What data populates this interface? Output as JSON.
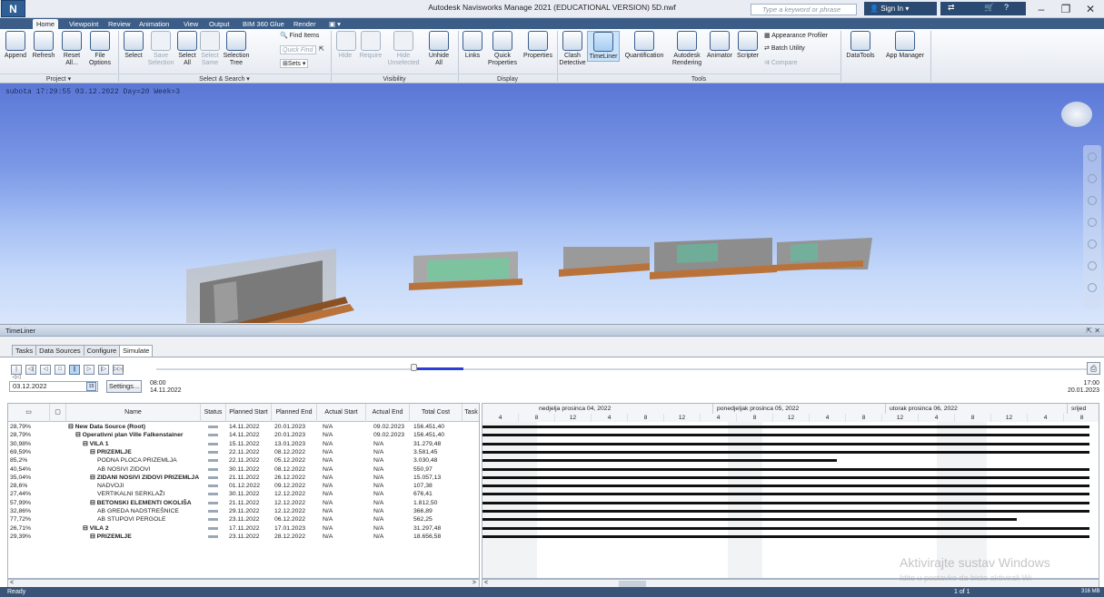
{
  "app": {
    "logo": "N",
    "title": "Autodesk Navisworks Manage 2021 (EDUCATIONAL VERSION)   5D.nwf",
    "search_placeholder": "Type a keyword or phrase",
    "signin": "Sign In",
    "window_controls": [
      "–",
      "❐",
      "✕"
    ]
  },
  "ribbon_tabs": [
    "Home",
    "Viewpoint",
    "Review",
    "Animation",
    "View",
    "Output",
    "BIM 360 Glue",
    "Render"
  ],
  "ribbon": {
    "project": {
      "label": "Project ▾",
      "buttons": [
        "Append",
        "Refresh",
        "Reset All...",
        "File Options"
      ]
    },
    "select_search": {
      "label": "Select & Search ▾",
      "buttons": [
        "Select",
        "Save Selection",
        "Select All",
        "Select Same",
        "Selection Tree"
      ],
      "find_items": "Find Items",
      "quick_find": "Quick Find",
      "sets": "Sets"
    },
    "visibility": {
      "label": "Visibility",
      "buttons": [
        "Hide",
        "Require",
        "Hide Unselected",
        "Unhide All"
      ]
    },
    "display": {
      "label": "Display",
      "buttons": [
        "Links",
        "Quick Properties",
        "Properties"
      ]
    },
    "tools": {
      "label": "Tools",
      "buttons": [
        "Clash Detective",
        "TimeLiner",
        "Quantification",
        "Autodesk Rendering",
        "Animator",
        "Scripter"
      ],
      "appearance_profiler": "Appearance Profiler",
      "batch_utility": "Batch Utility",
      "compare": "Compare"
    },
    "extra": [
      "DataTools",
      "App Manager"
    ]
  },
  "viewport": {
    "overlay": "subota 17:29:55 03.12.2022 Day=20 Week=3"
  },
  "timeliner": {
    "title": "TimeLiner",
    "close_controls": "⇱ ✕",
    "tabs": [
      "Tasks",
      "Data Sources",
      "Configure",
      "Simulate"
    ],
    "active_tab": "Simulate",
    "current_date": "03.12.2022",
    "calendar_icon": "15",
    "settings": "Settings...",
    "start_time": "08:00",
    "start_date": "14.11.2022",
    "end_time": "17:00",
    "end_date": "20.01.2023",
    "columns": [
      "",
      "",
      "Name",
      "Status",
      "Planned Start",
      "Planned End",
      "Actual Start",
      "Actual End",
      "Total Cost",
      "Task"
    ],
    "rows": [
      {
        "pct": "28,79%",
        "name": "⊟  New Data Source (Root)",
        "start": "14.11.2022",
        "end": "20.01.2023",
        "astart": "N/A",
        "aend": "09.02.2023",
        "cost": "156.451,40",
        "bold": true,
        "indent": 0
      },
      {
        "pct": "28,79%",
        "name": "⊟  Operativni plan  Ville Falkenstainer",
        "start": "14.11.2022",
        "end": "20.01.2023",
        "astart": "N/A",
        "aend": "09.02.2023",
        "cost": "156.451,40",
        "bold": true,
        "indent": 1
      },
      {
        "pct": "30,98%",
        "name": "⊟  VILA 1",
        "start": "15.11.2022",
        "end": "13.01.2023",
        "astart": "N/A",
        "aend": "N/A",
        "cost": "31.279,48",
        "bold": true,
        "indent": 2
      },
      {
        "pct": "69,59%",
        "name": "⊟  PRIZEMLJE",
        "start": "22.11.2022",
        "end": "08.12.2022",
        "astart": "N/A",
        "aend": "N/A",
        "cost": "3.581,45",
        "bold": true,
        "indent": 3
      },
      {
        "pct": "85,2%",
        "name": "PODNA PLOCA PRIZEMLJA",
        "start": "22.11.2022",
        "end": "05.12.2022",
        "astart": "N/A",
        "aend": "N/A",
        "cost": "3.030,48",
        "bold": false,
        "indent": 4
      },
      {
        "pct": "40,54%",
        "name": "AB NOSIVI ZIDOVI",
        "start": "30.11.2022",
        "end": "08.12.2022",
        "astart": "N/A",
        "aend": "N/A",
        "cost": "550,97",
        "bold": false,
        "indent": 4
      },
      {
        "pct": "35,04%",
        "name": "⊟  ZIDANI NOSIVI ZIDOVI PRIZEMLJA",
        "start": "21.11.2022",
        "end": "26.12.2022",
        "astart": "N/A",
        "aend": "N/A",
        "cost": "15.057,13",
        "bold": true,
        "indent": 3
      },
      {
        "pct": "28,6%",
        "name": "NADVOJI",
        "start": "01.12.2022",
        "end": "09.12.2022",
        "astart": "N/A",
        "aend": "N/A",
        "cost": "107,38",
        "bold": false,
        "indent": 4
      },
      {
        "pct": "27,44%",
        "name": "VERTIKALNI SERKLAŽI",
        "start": "30.11.2022",
        "end": "12.12.2022",
        "astart": "N/A",
        "aend": "N/A",
        "cost": "676,41",
        "bold": false,
        "indent": 4
      },
      {
        "pct": "57,99%",
        "name": "⊟  BETONSKI ELEMENTI OKOLIŠA",
        "start": "21.11.2022",
        "end": "12.12.2022",
        "astart": "N/A",
        "aend": "N/A",
        "cost": "1.812,50",
        "bold": true,
        "indent": 3
      },
      {
        "pct": "32,86%",
        "name": "AB GREDA NADSTREŠNICE",
        "start": "29.11.2022",
        "end": "12.12.2022",
        "astart": "N/A",
        "aend": "N/A",
        "cost": "366,89",
        "bold": false,
        "indent": 4
      },
      {
        "pct": "77,72%",
        "name": "AB STUPOVI PERGOLE",
        "start": "23.11.2022",
        "end": "06.12.2022",
        "astart": "N/A",
        "aend": "N/A",
        "cost": "562,25",
        "bold": false,
        "indent": 4
      },
      {
        "pct": "26,71%",
        "name": "⊟  VILA 2",
        "start": "17.11.2022",
        "end": "17.01.2023",
        "astart": "N/A",
        "aend": "N/A",
        "cost": "31.297,48",
        "bold": true,
        "indent": 2
      },
      {
        "pct": "29,39%",
        "name": "⊟  PRIZEMLJE",
        "start": "23.11.2022",
        "end": "28.12.2022",
        "astart": "N/A",
        "aend": "N/A",
        "cost": "18.656,58",
        "bold": true,
        "indent": 3
      }
    ],
    "gantt_days": [
      "nedjelja prosinca 04, 2022",
      "ponedjeljak prosinca 05, 2022",
      "utorak prosinca 06, 2022",
      "srijed"
    ],
    "gantt_hours": [
      "4",
      "8",
      "12",
      "4",
      "8",
      "12",
      "4",
      "8",
      "12",
      "4",
      "8",
      "12",
      "4",
      "8",
      "12",
      "4",
      "8"
    ]
  },
  "status": {
    "ready": "Ready",
    "page": "1 of 1",
    "memory": "316 MB"
  },
  "watermark": {
    "line1": "Aktivirajte sustav Windows",
    "line2": "Idite u postavke da biste aktivirali Wi"
  }
}
